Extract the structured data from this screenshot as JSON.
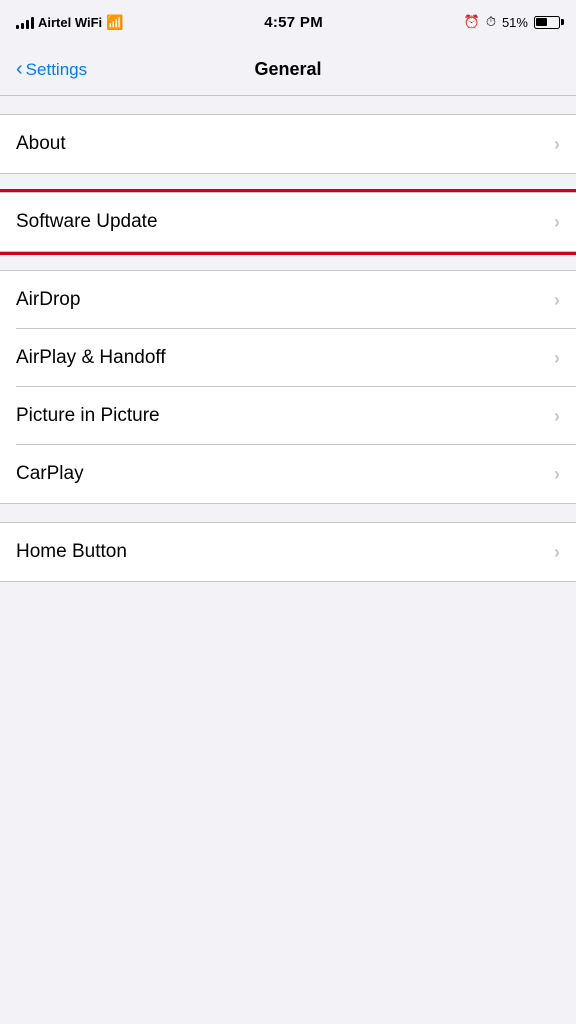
{
  "statusBar": {
    "carrier": "Airtel WiFi",
    "time": "4:57 PM",
    "batteryPercent": "51%"
  },
  "navBar": {
    "backLabel": "Settings",
    "title": "General"
  },
  "sections": [
    {
      "id": "section-about",
      "highlighted": false,
      "items": [
        {
          "id": "about",
          "label": "About"
        }
      ]
    },
    {
      "id": "section-software-update",
      "highlighted": true,
      "items": [
        {
          "id": "software-update",
          "label": "Software Update"
        }
      ]
    },
    {
      "id": "section-connectivity",
      "highlighted": false,
      "items": [
        {
          "id": "airdrop",
          "label": "AirDrop"
        },
        {
          "id": "airplay-handoff",
          "label": "AirPlay & Handoff"
        },
        {
          "id": "picture-in-picture",
          "label": "Picture in Picture"
        },
        {
          "id": "carplay",
          "label": "CarPlay"
        }
      ]
    },
    {
      "id": "section-homebutton",
      "highlighted": false,
      "items": [
        {
          "id": "home-button",
          "label": "Home Button"
        }
      ]
    }
  ]
}
